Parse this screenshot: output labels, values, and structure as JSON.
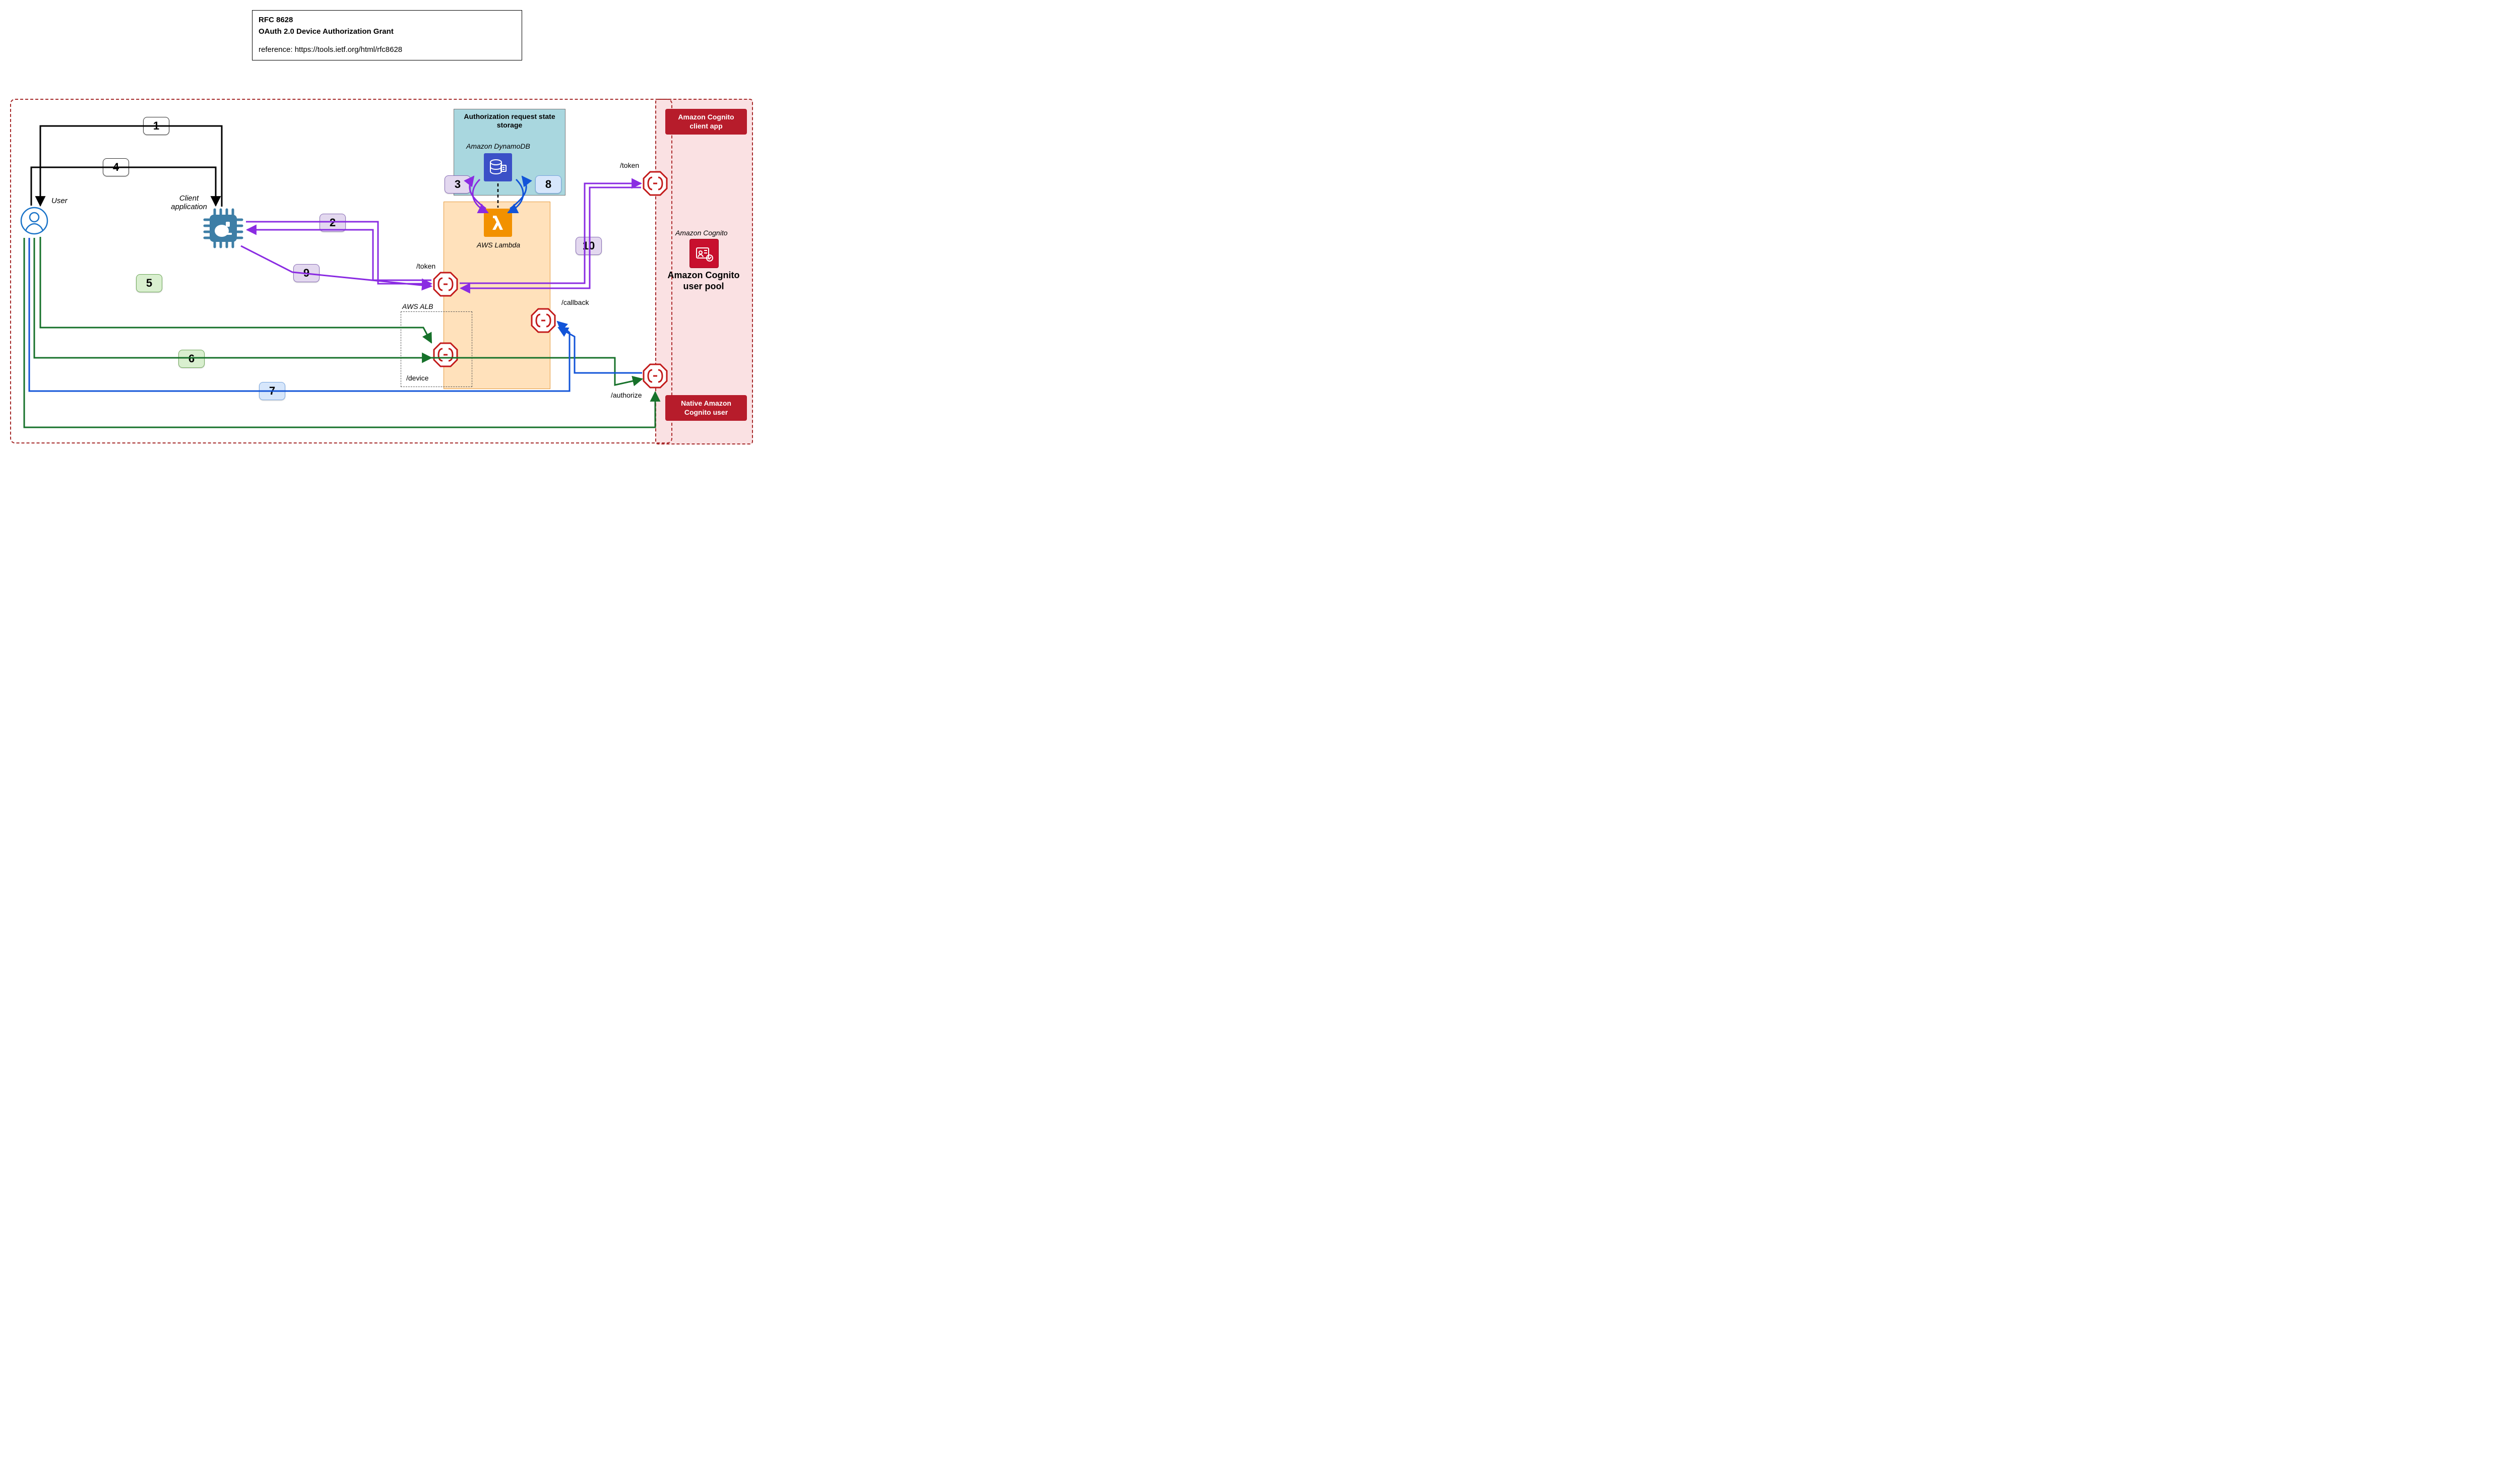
{
  "title": {
    "line1": "RFC 8628",
    "line2": "OAuth 2.0 Device Authorization Grant",
    "line3": "reference: https://tools.ietf.org/html/rfc8628"
  },
  "labels": {
    "user": "User",
    "client_app": "Client\napplication",
    "storage_hdr": "Authorization request state storage",
    "dynamodb": "Amazon DynamoDB",
    "lambda": "AWS Lambda",
    "alb": "AWS ALB",
    "cognito": "Amazon Cognito",
    "cognito_pool": "Amazon Cognito user pool",
    "cognito_client": "Amazon Cognito client app",
    "cognito_user": "Native Amazon Cognito user"
  },
  "endpoints": {
    "token_top": "/token",
    "token_mid": "/token",
    "callback": "/callback",
    "device": "/device",
    "authorize": "/authorize"
  },
  "steps": {
    "s1": "1",
    "s2": "2",
    "s3": "3",
    "s4": "4",
    "s5": "5",
    "s6": "6",
    "s7": "7",
    "s8": "8",
    "s9": "9",
    "s10": "10"
  }
}
